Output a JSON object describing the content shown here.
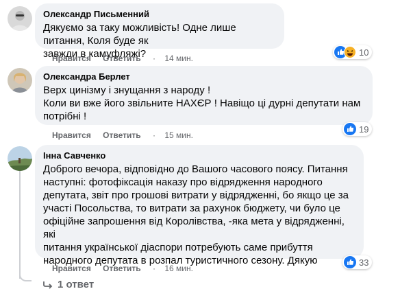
{
  "comments": [
    {
      "author": "Олександр Письменний",
      "lines": [
        "Дякуємо за таку можливість! Одне лише питання, Коля буде як",
        "завжди в камуфляжі?"
      ],
      "like_label": "Нравится",
      "reply_label": "Ответить",
      "time": "14 мин.",
      "reactions": [
        "like-icon",
        "haha-icon"
      ],
      "reaction_count": "10"
    },
    {
      "author": "Олександра Берлет",
      "lines": [
        "Верх цинізму і знущання з народу !",
        "Коли ви вже його звільните НАХЄР ! Навіщо ці дурні депутати нам",
        "потрібні !"
      ],
      "like_label": "Нравится",
      "reply_label": "Ответить",
      "time": "15 мин.",
      "reactions": [
        "like-icon"
      ],
      "reaction_count": "19"
    },
    {
      "author": "Інна Савченко",
      "lines": [
        "Доброго вечора, відповідно до Вашого часового поясу. Питання",
        "наступні: фотофіксація наказу про відрядження народного",
        "депутата, звіт про грошові витрати у відрядженні, бо якщо це за",
        "участі Посольства, то витрати за рахунок бюджету, чи було це",
        "офіційне запрошення від Королівства, -яка мета у відрядженні, які",
        "питання української діаспори потребують саме прибуття",
        "народного депутата в розпал туристичного сезону. Дякую"
      ],
      "like_label": "Нравится",
      "reply_label": "Ответить",
      "time": "16 мин.",
      "reactions": [
        "like-icon"
      ],
      "reaction_count": "33"
    }
  ],
  "replies_label": "1 ответ",
  "dot": "·",
  "colors": {
    "bubble": "#f0f2f5",
    "meta": "#65676b",
    "like": "#1877f2",
    "haha": "#f7b125"
  }
}
